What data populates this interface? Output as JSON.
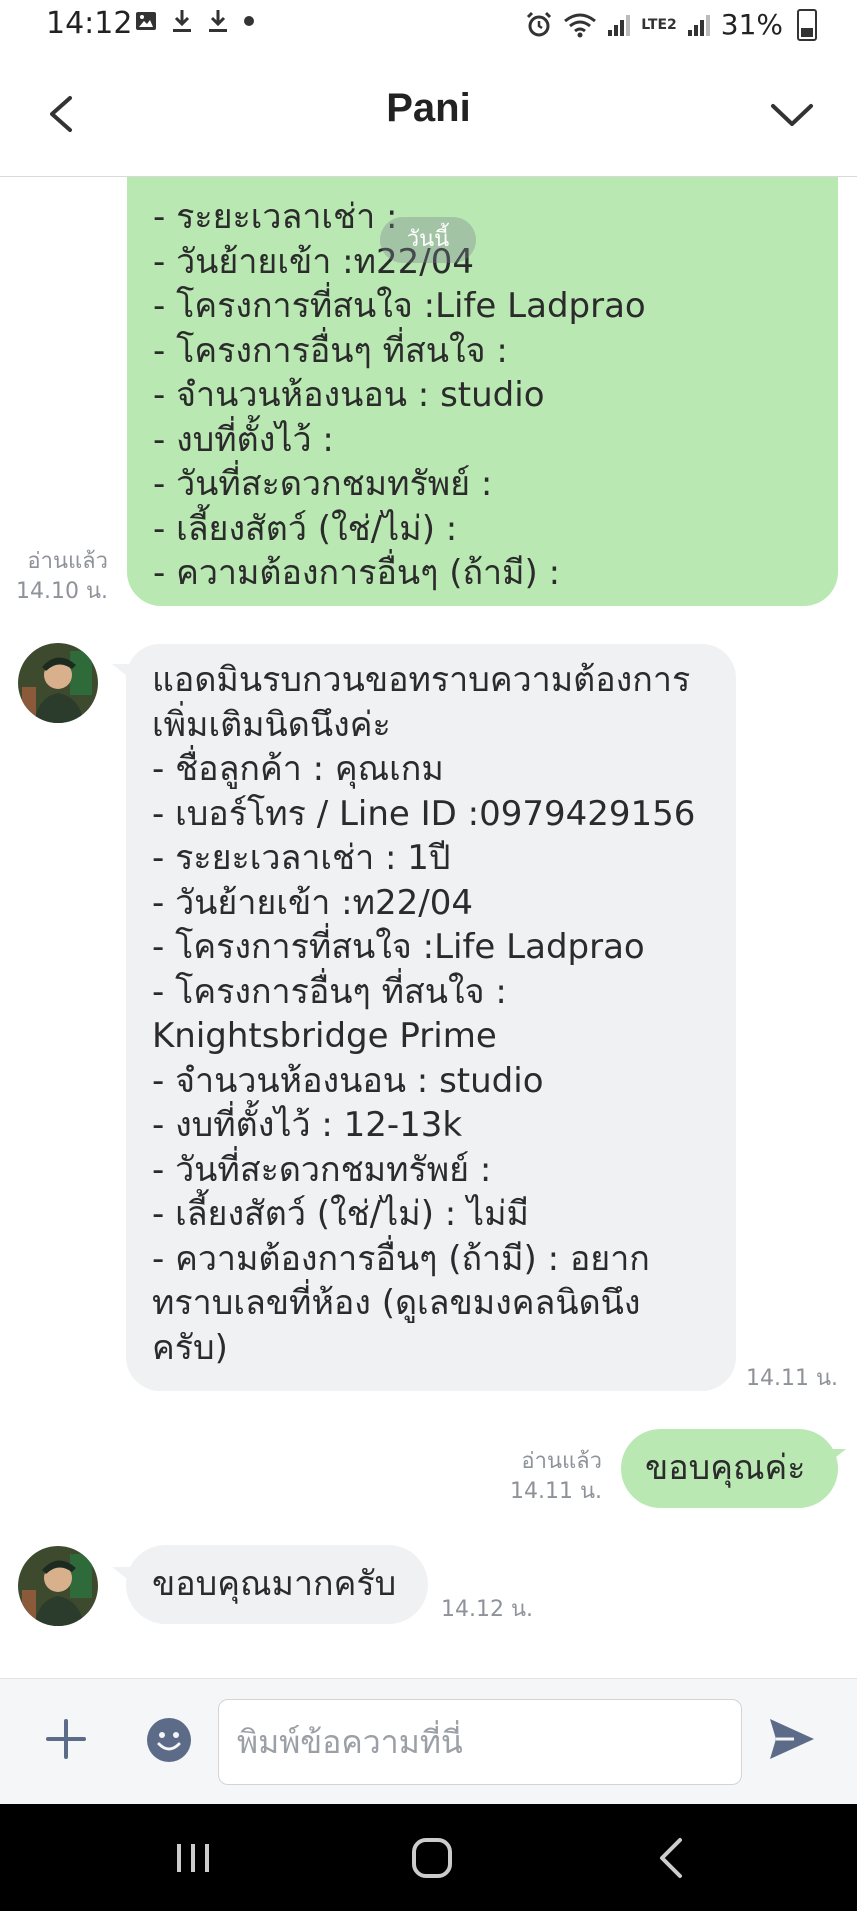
{
  "status_bar": {
    "time": "14:12",
    "battery": "31%",
    "network_label": "LTE2"
  },
  "header": {
    "title": "Pani"
  },
  "chat": {
    "date_divider": "วันนี้",
    "messages": [
      {
        "direction": "outgoing",
        "lines": [
          "- ระยะเวลาเช่า :",
          "- วันย้ายเข้า :ท22/04",
          "- โครงการที่สนใจ :Life Ladprao",
          "- โครงการอื่นๆ ที่สนใจ :",
          "- จำนวนห้องนอน : studio",
          "- งบที่ตั้งไว้ :",
          "- วันที่สะดวกชมทรัพย์ :",
          "- เลี้ยงสัตว์ (ใช่/ไม่) :",
          "- ความต้องการอื่นๆ (ถ้ามี) :"
        ],
        "read_label": "อ่านแล้ว",
        "time": "14.10 น."
      },
      {
        "direction": "incoming",
        "lines": [
          "แอดมินรบกวนขอทราบความต้องการ",
          "เพิ่มเติมนิดนึงค่ะ",
          "- ชื่อลูกค้า : คุณเกม",
          "- เบอร์โทร / Line ID :0979429156",
          "- ระยะเวลาเช่า : 1ปี",
          "- วันย้ายเข้า :ท22/04",
          "- โครงการที่สนใจ :Life Ladprao",
          "- โครงการอื่นๆ ที่สนใจ :",
          "Knightsbridge Prime",
          "- จำนวนห้องนอน : studio",
          "- งบที่ตั้งไว้ : 12-13k",
          "- วันที่สะดวกชมทรัพย์ :",
          "- เลี้ยงสัตว์ (ใช่/ไม่) : ไม่มี",
          "- ความต้องการอื่นๆ (ถ้ามี) : อยาก",
          "ทราบเลขที่ห้อง (ดูเลขมงคลนิดนึง",
          "ครับ)"
        ],
        "time": "14.11 น."
      },
      {
        "direction": "outgoing",
        "text": "ขอบคุณค่ะ",
        "read_label": "อ่านแล้ว",
        "time": "14.11 น."
      },
      {
        "direction": "incoming",
        "text": "ขอบคุณมากครับ",
        "time": "14.12 น."
      }
    ]
  },
  "input_bar": {
    "placeholder": "พิมพ์ข้อความที่นี่"
  },
  "colors": {
    "outgoing_bubble": "#b9e8b3",
    "incoming_bubble": "#f0f1f3",
    "icon_gray": "#5c6b87",
    "meta_text": "#8e9299"
  },
  "icons": {
    "back": "chevron-left-icon",
    "more": "chevron-down-icon",
    "plus": "plus-icon",
    "emoji": "emoji-icon",
    "send": "send-icon",
    "nav_recents": "recents-icon",
    "nav_home": "home-icon",
    "nav_back": "back-icon"
  }
}
